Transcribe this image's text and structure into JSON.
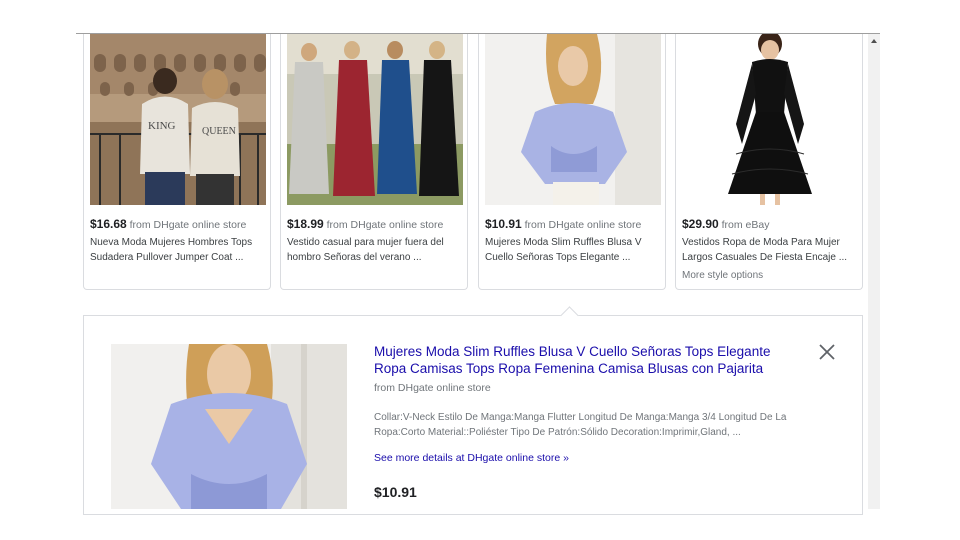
{
  "products": [
    {
      "price": "$16.68",
      "source": "from DHgate online store",
      "title": "Nueva Moda Mujeres Hombres Tops Sudadera Pullover Jumper Coat ...",
      "extra": ""
    },
    {
      "price": "$18.99",
      "source": "from DHgate online store",
      "title": "Vestido casual para mujer fuera del hombro Señoras del verano ...",
      "extra": ""
    },
    {
      "price": "$10.91",
      "source": "from DHgate online store",
      "title": "Mujeres Moda Slim Ruffles Blusa V Cuello Señoras Tops Elegante ...",
      "extra": ""
    },
    {
      "price": "$29.90",
      "source": "from eBay",
      "title": "Vestidos Ropa de Moda Para Mujer Largos Casuales De Fiesta Encaje ...",
      "extra": "More style options"
    }
  ],
  "detail": {
    "title": "Mujeres Moda Slim Ruffles Blusa V Cuello Señoras Tops Elegante Ropa Camisas Tops Ropa Femenina Camisa Blusas con Pajarita",
    "source": "from DHgate online store",
    "description": "Collar:V-Neck Estilo De Manga:Manga Flutter Longitud De Manga:Manga 3/4 Longitud De La Ropa:Corto Material::Poliéster Tipo De Patrón:Sólido Decoration:Imprimir,Gland, ...",
    "link": "See more details at DHgate online store »",
    "price": "$10.91"
  },
  "icons": {
    "close": "close-icon",
    "scroll_up": "scroll-up-arrow-icon"
  },
  "colors": {
    "link": "#1a0dab",
    "muted": "#70757a",
    "border": "#dadce0"
  }
}
